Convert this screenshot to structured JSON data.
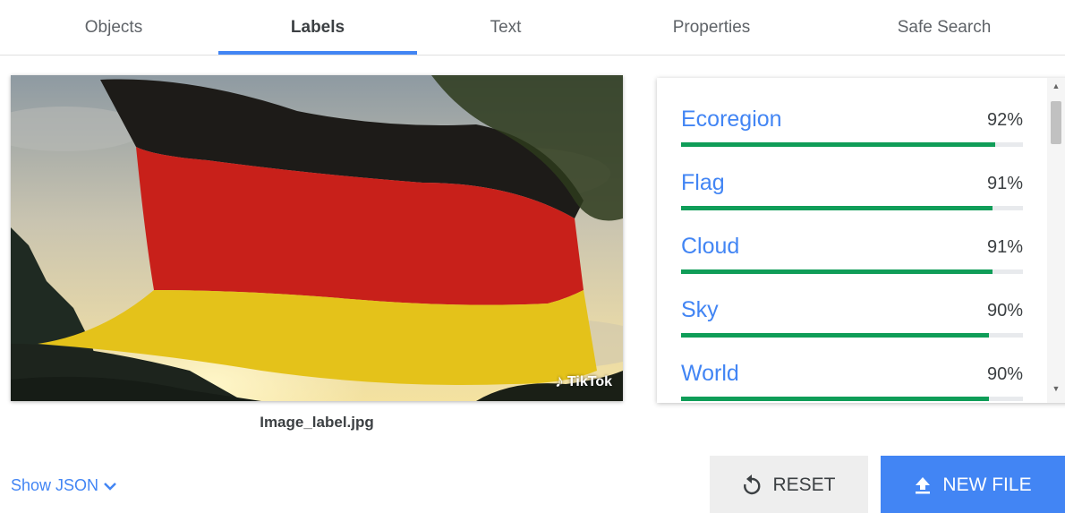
{
  "tabs": [
    {
      "label": "Objects"
    },
    {
      "label": "Labels"
    },
    {
      "label": "Text"
    },
    {
      "label": "Properties"
    },
    {
      "label": "Safe Search"
    }
  ],
  "active_tab": "Labels",
  "image": {
    "filename": "Image_label.jpg",
    "watermark": "TikTok"
  },
  "labels": [
    {
      "name": "Ecoregion",
      "score": "92%",
      "value": 0.92
    },
    {
      "name": "Flag",
      "score": "91%",
      "value": 0.91
    },
    {
      "name": "Cloud",
      "score": "91%",
      "value": 0.91
    },
    {
      "name": "Sky",
      "score": "90%",
      "value": 0.9
    },
    {
      "name": "World",
      "score": "90%",
      "value": 0.9
    }
  ],
  "footer": {
    "show_json": "Show JSON",
    "reset": "RESET",
    "new_file": "NEW FILE"
  },
  "colors": {
    "accent": "#4285f4",
    "bar_fill": "#0f9d58",
    "bar_track": "#e8eaed"
  }
}
